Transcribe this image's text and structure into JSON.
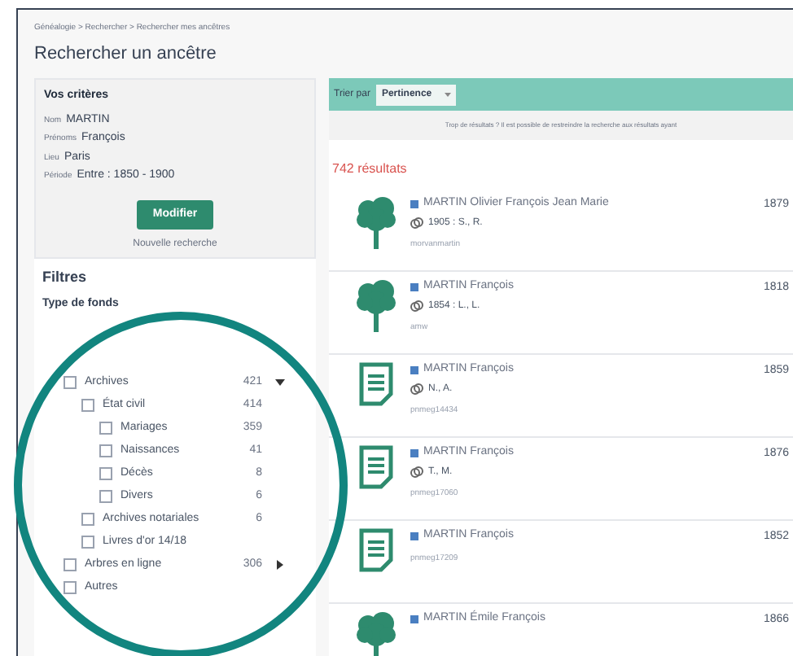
{
  "breadcrumb": "Généalogie > Rechercher > Rechercher mes ancêtres",
  "title": "Rechercher un ancêtre",
  "criteria": {
    "heading": "Vos critères",
    "fields": [
      {
        "label": "Nom",
        "value": "MARTIN"
      },
      {
        "label": "Prénoms",
        "value": "François"
      },
      {
        "label": "Lieu",
        "value": "Paris"
      },
      {
        "label": "Période",
        "value": "Entre : 1850 - 1900"
      }
    ],
    "button": "Modifier",
    "link": "Nouvelle recherche"
  },
  "filters": {
    "heading": "Filtres",
    "group": "Type de fonds",
    "items": [
      {
        "label": "Archives",
        "count": "421",
        "checked": false,
        "expanded": true,
        "children": [
          {
            "label": "État civil",
            "count": "414",
            "checked": false,
            "children": [
              {
                "label": "Mariages",
                "count": "359",
                "checked": false
              },
              {
                "label": "Naissances",
                "count": "41",
                "checked": false
              },
              {
                "label": "Décès",
                "count": "8",
                "checked": false
              },
              {
                "label": "Divers",
                "count": "6",
                "checked": false
              }
            ]
          },
          {
            "label": "Archives notariales",
            "count": "6",
            "checked": false
          },
          {
            "label": "Livres d'or 14/18",
            "checked": false
          }
        ]
      },
      {
        "label": "Arbres en ligne",
        "count": "306",
        "checked": false,
        "expanded": false
      },
      {
        "label": "Autres",
        "checked": false
      }
    ]
  },
  "sort": {
    "label": "Trier par",
    "value": "Pertinence"
  },
  "notice": "Trop de résultats ? Il est possible de restreindre la recherche aux résultats ayant",
  "count": "742 résultats",
  "results": [
    {
      "kind": "tree",
      "name": "MARTIN Olivier François Jean Marie",
      "detail": "1905 : S., R.",
      "source": "morvanmartin",
      "year": "1879"
    },
    {
      "kind": "tree",
      "name": "MARTIN François",
      "detail": "1854 : L., L.",
      "source": "amw",
      "year": "1818"
    },
    {
      "kind": "record",
      "name": "MARTIN François",
      "detail": "N., A.",
      "source": "pnmeg14434",
      "year": "1859"
    },
    {
      "kind": "record",
      "name": "MARTIN François",
      "detail": "T., M.",
      "source": "pnmeg17060",
      "year": "1876"
    },
    {
      "kind": "record",
      "name": "MARTIN François",
      "source": "pnmeg17209",
      "year": "1852"
    },
    {
      "kind": "tree",
      "name": "MARTIN Émile François",
      "year": "1866"
    }
  ]
}
